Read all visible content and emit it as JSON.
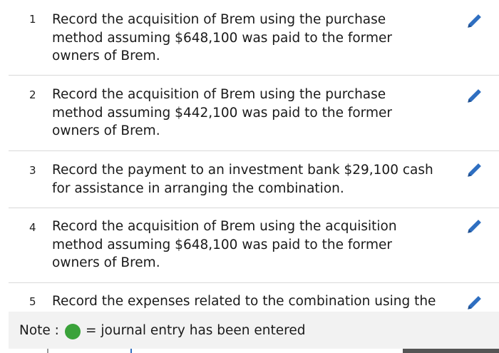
{
  "items": [
    {
      "number": "1",
      "text": "Record the acquisition of Brem using the purchase method assuming $648,100 was paid to the former owners of Brem.",
      "icon": "pencil-icon"
    },
    {
      "number": "2",
      "text": "Record the acquisition of Brem using the purchase method assuming $442,100 was paid to the former owners of Brem.",
      "icon": "pencil-icon"
    },
    {
      "number": "3",
      "text": "Record the payment to an investment bank $29,100 cash for assistance in arranging the combination.",
      "icon": "pencil-icon"
    },
    {
      "number": "4",
      "text": "Record the acquisition of Brem using the acquisition method assuming $648,100 was paid to the former owners of Brem.",
      "icon": "pencil-icon"
    },
    {
      "number": "5",
      "text": "Record the expenses related to the combination using the",
      "icon": "pencil-icon"
    }
  ],
  "note": {
    "label": "Note :",
    "description": "= journal entry has been entered",
    "dot_icon": "green-dot-icon"
  },
  "colors": {
    "accent": "#2f6fc1",
    "entered": "#3aa23a",
    "divider": "#d9d9d9",
    "note_bg": "#f2f2f2"
  }
}
